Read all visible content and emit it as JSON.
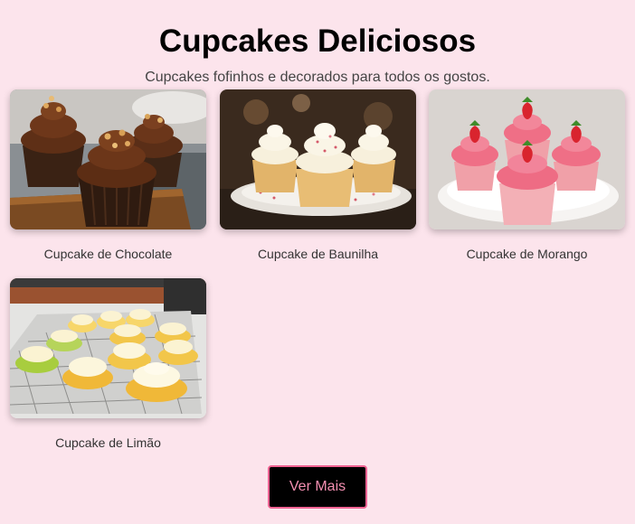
{
  "header": {
    "title": "Cupcakes Deliciosos",
    "subtitle": "Cupcakes fofinhos e decorados para todos os gostos."
  },
  "cupcakes": [
    {
      "name": "Cupcake de Chocolate",
      "image": "chocolate-cupcakes-photo"
    },
    {
      "name": "Cupcake de Baunilha",
      "image": "vanilla-cupcakes-photo"
    },
    {
      "name": "Cupcake de Morango",
      "image": "strawberry-cupcakes-photo"
    },
    {
      "name": "Cupcake de Limão",
      "image": "lemon-cupcakes-photo"
    }
  ],
  "actions": {
    "more_label": "Ver Mais"
  },
  "colors": {
    "background": "#fce4ec",
    "button_background": "#000000",
    "button_border": "#f06292",
    "button_text": "#f48fb1"
  }
}
